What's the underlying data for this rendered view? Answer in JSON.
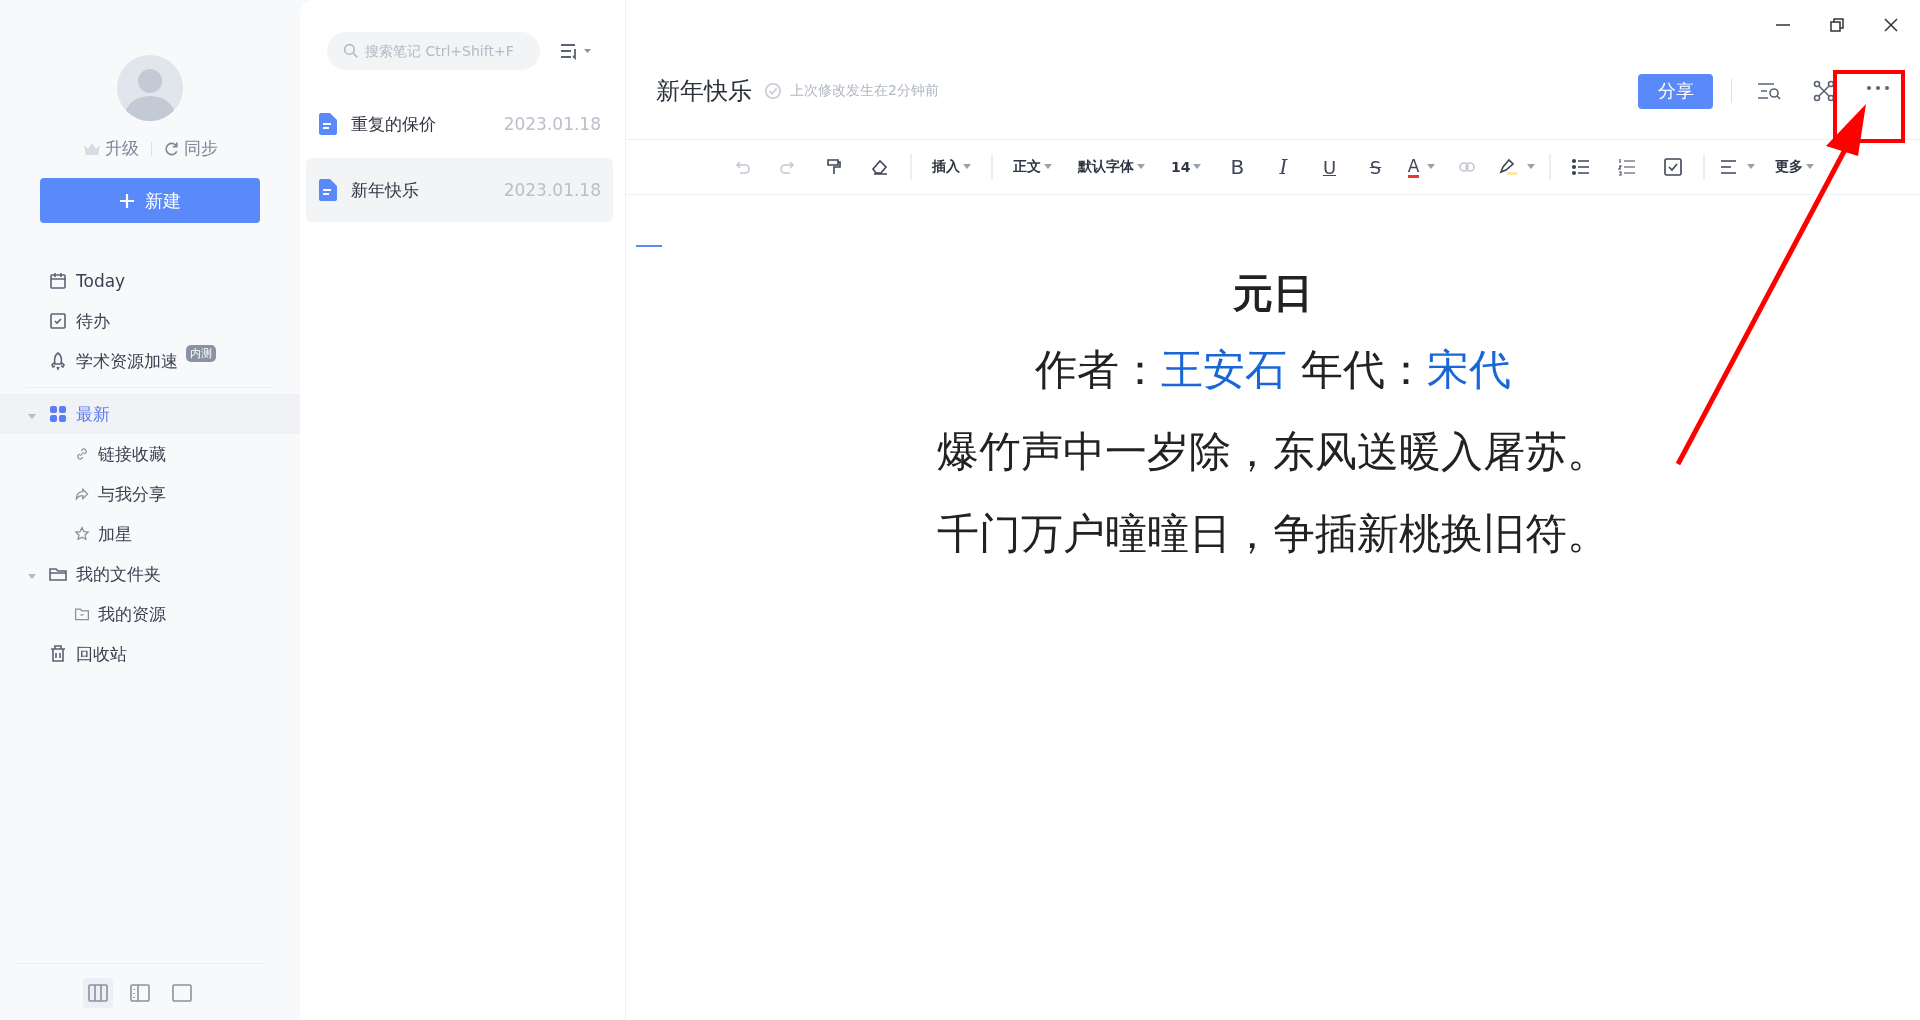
{
  "sidebar": {
    "upgrade": "升级",
    "sync": "同步",
    "new_button": "新建",
    "items": [
      {
        "kind": "calendar",
        "label": "Today",
        "selected": false
      },
      {
        "kind": "todo",
        "label": "待办",
        "selected": false
      },
      {
        "kind": "rocket",
        "label": "学术资源加速",
        "badge": "内测",
        "selected": false
      }
    ],
    "tree": [
      {
        "kind": "grid",
        "label": "最新",
        "selected": true,
        "expanded": true,
        "children": [
          {
            "kind": "link",
            "label": "链接收藏",
            "selected": false
          },
          {
            "kind": "share",
            "label": "与我分享",
            "selected": false
          },
          {
            "kind": "star",
            "label": "加星",
            "selected": false
          }
        ]
      },
      {
        "kind": "folder",
        "label": "我的文件夹",
        "selected": false,
        "expanded": true,
        "children": [
          {
            "kind": "subfolder",
            "label": "我的资源",
            "selected": false
          }
        ]
      },
      {
        "kind": "trash",
        "label": "回收站",
        "selected": false
      }
    ],
    "layouts": [
      {
        "kind": "three",
        "selected": true
      },
      {
        "kind": "two",
        "selected": false
      },
      {
        "kind": "one",
        "selected": false
      }
    ]
  },
  "note_list": {
    "search": {
      "placeholder": "搜索笔记 Ctrl+Shift+F"
    },
    "notes": [
      {
        "title": "重复的保价",
        "date": "2023.01.18",
        "selected": false
      },
      {
        "title": "新年快乐",
        "date": "2023.01.18",
        "selected": true
      }
    ]
  },
  "editor": {
    "title": "新年快乐",
    "status": "上次修改发生在2分钟前",
    "share_button": "分享",
    "toolbar": [
      {
        "kind": "undo",
        "disabled": true
      },
      {
        "kind": "redo",
        "disabled": true
      },
      {
        "kind": "painter",
        "disabled": false
      },
      {
        "kind": "eraser",
        "disabled": false
      },
      {
        "kind": "sep"
      },
      {
        "kind": "menu",
        "label": "插入"
      },
      {
        "kind": "sep"
      },
      {
        "kind": "menu",
        "label": "正文"
      },
      {
        "kind": "menu",
        "label": "默认字体"
      },
      {
        "kind": "menu",
        "label": "14"
      },
      {
        "kind": "bold",
        "label": "B",
        "disabled": false
      },
      {
        "kind": "italic",
        "label": "I",
        "disabled": false
      },
      {
        "kind": "underline",
        "label": "U",
        "disabled": false
      },
      {
        "kind": "strike",
        "label": "S",
        "disabled": false
      },
      {
        "kind": "color",
        "label": "A",
        "disabled": false
      },
      {
        "kind": "link",
        "disabled": true
      },
      {
        "kind": "highlight",
        "disabled": false
      },
      {
        "kind": "sep"
      },
      {
        "kind": "bullets",
        "disabled": false
      },
      {
        "kind": "numbers",
        "disabled": false
      },
      {
        "kind": "check",
        "disabled": false
      },
      {
        "kind": "sep"
      },
      {
        "kind": "align",
        "disabled": false
      },
      {
        "kind": "menu",
        "label": "更多"
      }
    ],
    "content": [
      {
        "kind": "heading",
        "parts": [
          {
            "text": "元日",
            "link": false
          }
        ]
      },
      {
        "kind": "line",
        "parts": [
          {
            "text": "作者：",
            "link": false
          },
          {
            "text": "王安石",
            "link": true
          },
          {
            "text": " 年代：",
            "link": false
          },
          {
            "text": "宋代",
            "link": true
          }
        ]
      },
      {
        "kind": "line",
        "parts": [
          {
            "text": "爆竹声中一岁除，东风送暖入屠苏。",
            "link": false
          }
        ]
      },
      {
        "kind": "line",
        "parts": [
          {
            "text": "千门万户曈曈日，争插新桃换旧符。",
            "link": false
          }
        ]
      }
    ]
  }
}
